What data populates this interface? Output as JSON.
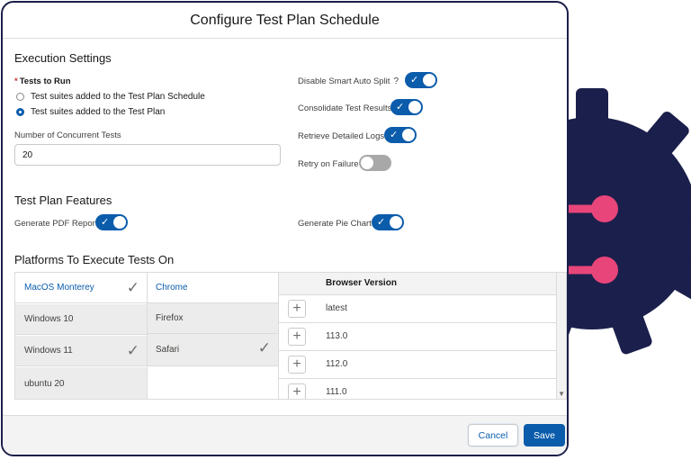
{
  "modal": {
    "title": "Configure Test Plan Schedule"
  },
  "execution": {
    "section_title": "Execution Settings",
    "tests_to_run": {
      "required_mark": "*",
      "label": "Tests to Run",
      "options": [
        {
          "label": "Test suites added to the Test Plan Schedule",
          "checked": false
        },
        {
          "label": "Test suites added to the Test Plan",
          "checked": true
        }
      ]
    },
    "concurrent": {
      "label": "Number of Concurrent Tests",
      "value": "20"
    },
    "toggles": [
      {
        "label": "Disable Smart Auto Split",
        "help": "?",
        "on": true
      },
      {
        "label": "Consolidate Test Results",
        "on": true
      },
      {
        "label": "Retrieve Detailed Logs",
        "on": true
      },
      {
        "label": "Retry on Failure",
        "on": false
      }
    ]
  },
  "features": {
    "section_title": "Test Plan Features",
    "toggles": [
      {
        "label": "Generate PDF Report",
        "on": true
      },
      {
        "label": "Generate Pie Chart",
        "on": true
      }
    ]
  },
  "platforms": {
    "section_title": "Platforms To Execute Tests On",
    "os": [
      {
        "label": "MacOS Monterey",
        "active": true,
        "checked": true
      },
      {
        "label": "Windows 10",
        "active": false,
        "checked": false
      },
      {
        "label": "Windows 11",
        "active": false,
        "checked": true
      },
      {
        "label": "ubuntu 20",
        "active": false,
        "checked": false
      }
    ],
    "browsers": [
      {
        "label": "Chrome",
        "active": true,
        "checked": false
      },
      {
        "label": "Firefox",
        "active": false,
        "checked": false
      },
      {
        "label": "Safari",
        "active": false,
        "checked": true
      }
    ],
    "version_header": "Browser Version",
    "versions": [
      "latest",
      "113.0",
      "112.0",
      "111.0"
    ],
    "check_glyph": "✓",
    "plus_glyph": "+"
  },
  "footer": {
    "cancel_label": "Cancel",
    "save_label": "Save"
  },
  "colors": {
    "accent": "#0b5cab",
    "gear_dark": "#1b1f4b",
    "gear_icon": "#e8457a",
    "toggle_off": "#a8a8a8"
  },
  "icons": {
    "toggle_check": "check-icon",
    "decor": "gear-branch-icon"
  }
}
